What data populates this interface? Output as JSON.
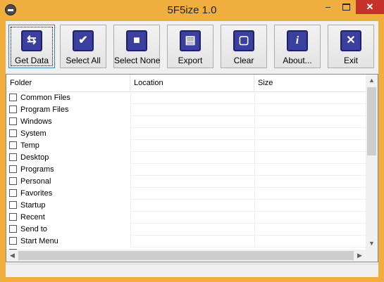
{
  "app": {
    "title": "5F5ize 1.0"
  },
  "titlebar": {
    "minimize": "–",
    "close": "✕"
  },
  "toolbar": {
    "buttons": [
      {
        "label": "Get Data",
        "icon": "folder-icon",
        "glyph": "⇆"
      },
      {
        "label": "Select All",
        "icon": "checkmark-icon",
        "glyph": "✔"
      },
      {
        "label": "Select None",
        "icon": "square-icon",
        "glyph": "■"
      },
      {
        "label": "Export",
        "icon": "export-icon",
        "glyph": "▤"
      },
      {
        "label": "Clear",
        "icon": "clear-icon",
        "glyph": "▢"
      },
      {
        "label": "About...",
        "icon": "info-icon",
        "glyph": "i"
      },
      {
        "label": "Exit",
        "icon": "close-x-icon",
        "glyph": "✕"
      }
    ]
  },
  "list": {
    "columns": [
      "Folder",
      "Location",
      "Size"
    ],
    "rows": [
      "Common Files",
      "Program Files",
      "Windows",
      "System",
      "Temp",
      "Desktop",
      "Programs",
      "Personal",
      "Favorites",
      "Startup",
      "Recent",
      "Send to",
      "Start Menu"
    ]
  },
  "scrollbar": {
    "up": "▲",
    "down": "▼",
    "left": "◀",
    "right": "▶"
  },
  "colors": {
    "titlebar": "#f0ae3e",
    "close": "#c7312b",
    "icon_fill": "#3b3f9e"
  }
}
